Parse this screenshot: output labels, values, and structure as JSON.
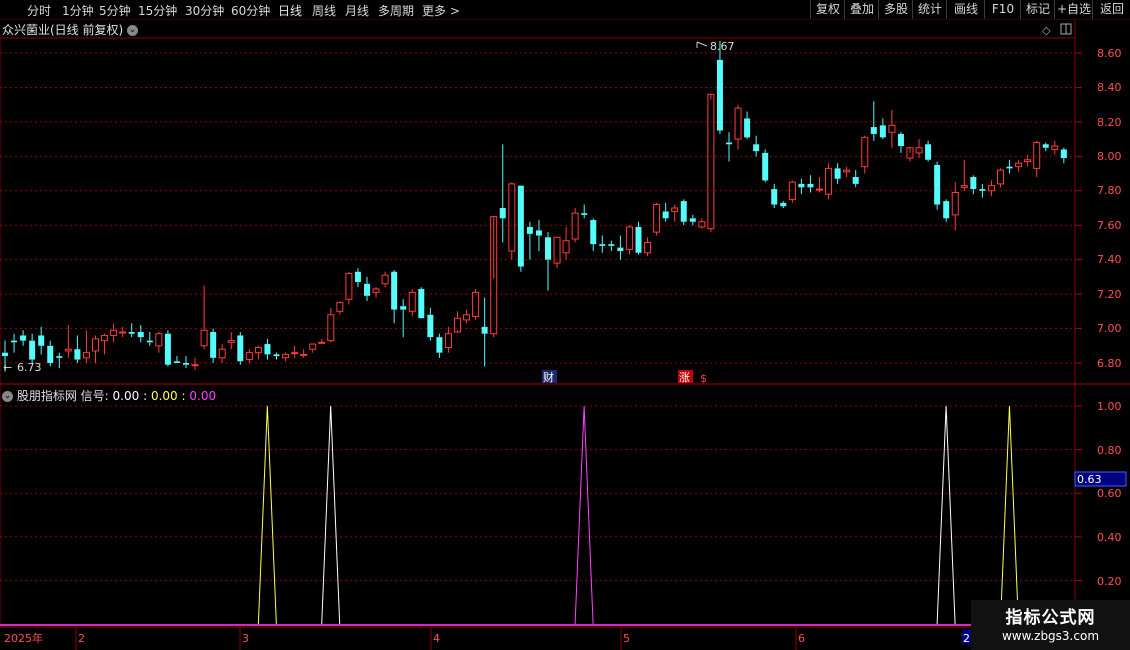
{
  "toolbar": {
    "left": [
      "分时",
      "1分钟",
      "5分钟",
      "15分钟",
      "30分钟",
      "60分钟",
      "日线",
      "周线",
      "月线",
      "多周期",
      "更多 >"
    ],
    "right": [
      "复权",
      "叠加",
      "多股",
      "统计",
      "画线",
      "F10",
      "标记",
      "+自选",
      "返回"
    ],
    "active": "日线"
  },
  "stock": {
    "title": "众兴菌业(日线 前复权)"
  },
  "main_chart": {
    "price_axis": [
      "8.60",
      "8.40",
      "8.20",
      "8.00",
      "7.80",
      "7.60",
      "7.40",
      "7.20",
      "7.00",
      "6.80"
    ],
    "high_label": "8.67",
    "low_label": "6.73",
    "markers": {
      "finance": "财",
      "rise": "涨",
      "dollar": "$"
    }
  },
  "indicator": {
    "name": "股朋指标网",
    "signal_label": "信号:",
    "v1": "0.00",
    "v2": "0.00",
    "v3": "0.00",
    "axis": [
      "1.00",
      "0.80",
      "0.60",
      "0.40",
      "0.20"
    ],
    "current": "0.63"
  },
  "date_axis": {
    "year": "2025年",
    "months": [
      "2",
      "3",
      "4",
      "5",
      "6"
    ],
    "last": "2"
  },
  "watermark": {
    "line1": "指标公式网",
    "line2": "www.zbgs3.com"
  },
  "colors": {
    "up": "#ff3b3b",
    "down": "#54fcfc",
    "yellow": "#ffff55",
    "white": "#ffffff",
    "magenta": "#ff44ff",
    "grid": "#8b0000"
  },
  "chart_data": {
    "type": "candlestick",
    "title": "众兴菌业(日线 前复权)",
    "ylim": [
      6.7,
      8.7
    ],
    "candles": [
      [
        6.86,
        6.93,
        6.84,
        6.75
      ],
      [
        6.93,
        6.97,
        6.92,
        6.86
      ],
      [
        6.96,
        6.99,
        6.93,
        6.9
      ],
      [
        6.93,
        6.97,
        6.82,
        6.8
      ],
      [
        6.96,
        7.01,
        6.9,
        6.85
      ],
      [
        6.9,
        6.93,
        6.8,
        6.78
      ],
      [
        6.84,
        6.86,
        6.83,
        6.77
      ],
      [
        6.87,
        7.02,
        6.88,
        6.83
      ],
      [
        6.88,
        6.96,
        6.82,
        6.8
      ],
      [
        6.83,
        6.99,
        6.86,
        6.8
      ],
      [
        6.87,
        6.96,
        6.94,
        6.8
      ],
      [
        6.93,
        6.97,
        6.96,
        6.85
      ],
      [
        6.96,
        7.03,
        6.99,
        6.92
      ],
      [
        6.98,
        7.01,
        6.98,
        6.95
      ],
      [
        6.98,
        7.03,
        6.97,
        6.95
      ],
      [
        6.98,
        7.02,
        6.95,
        6.92
      ],
      [
        6.93,
        6.98,
        6.92,
        6.9
      ],
      [
        6.9,
        6.98,
        6.97,
        6.86
      ],
      [
        6.97,
        6.99,
        6.79,
        6.78
      ],
      [
        6.81,
        6.84,
        6.8,
        6.8
      ],
      [
        6.8,
        6.84,
        6.79,
        6.77
      ],
      [
        6.79,
        6.83,
        6.79,
        6.76
      ],
      [
        6.9,
        7.25,
        6.99,
        6.88
      ],
      [
        6.98,
        7.0,
        6.83,
        6.8
      ],
      [
        6.83,
        6.91,
        6.88,
        6.8
      ],
      [
        6.92,
        6.98,
        6.93,
        6.88
      ],
      [
        6.96,
        6.98,
        6.81,
        6.79
      ],
      [
        6.82,
        6.88,
        6.86,
        6.8
      ],
      [
        6.86,
        6.9,
        6.89,
        6.82
      ],
      [
        6.91,
        6.94,
        6.85,
        6.82
      ],
      [
        6.85,
        6.86,
        6.84,
        6.82
      ],
      [
        6.83,
        6.86,
        6.85,
        6.81
      ],
      [
        6.86,
        6.9,
        6.86,
        6.83
      ],
      [
        6.85,
        6.88,
        6.85,
        6.83
      ],
      [
        6.88,
        6.91,
        6.91,
        6.86
      ],
      [
        6.92,
        6.94,
        6.92,
        6.92
      ],
      [
        6.93,
        7.12,
        7.08,
        6.92
      ],
      [
        7.1,
        7.16,
        7.15,
        7.08
      ],
      [
        7.17,
        7.33,
        7.32,
        7.14
      ],
      [
        7.33,
        7.35,
        7.27,
        7.24
      ],
      [
        7.26,
        7.3,
        7.19,
        7.16
      ],
      [
        7.21,
        7.24,
        7.23,
        7.18
      ],
      [
        7.26,
        7.33,
        7.31,
        7.24
      ],
      [
        7.33,
        7.34,
        7.11,
        7.03
      ],
      [
        7.13,
        7.17,
        7.11,
        6.95
      ],
      [
        7.1,
        7.23,
        7.21,
        7.07
      ],
      [
        7.23,
        7.24,
        7.06,
        7.06
      ],
      [
        7.08,
        7.12,
        6.95,
        6.93
      ],
      [
        6.95,
        6.97,
        6.86,
        6.83
      ],
      [
        6.89,
        7.01,
        6.97,
        6.86
      ],
      [
        6.98,
        7.1,
        7.06,
        6.99
      ],
      [
        7.05,
        7.11,
        7.08,
        7.03
      ],
      [
        7.07,
        7.23,
        7.21,
        7.05
      ],
      [
        7.01,
        7.18,
        6.97,
        6.78
      ],
      [
        6.97,
        7.29,
        7.65,
        6.95
      ],
      [
        7.7,
        8.07,
        7.64,
        7.5
      ],
      [
        7.45,
        7.85,
        7.84,
        7.4
      ],
      [
        7.83,
        7.83,
        7.36,
        7.33
      ],
      [
        7.59,
        7.62,
        7.55,
        7.4
      ],
      [
        7.57,
        7.63,
        7.54,
        7.45
      ],
      [
        7.53,
        7.56,
        7.4,
        7.22
      ],
      [
        7.38,
        7.53,
        7.53,
        7.35
      ],
      [
        7.44,
        7.59,
        7.51,
        7.4
      ],
      [
        7.52,
        7.7,
        7.67,
        7.5
      ],
      [
        7.67,
        7.72,
        7.66,
        7.64
      ],
      [
        7.63,
        7.64,
        7.49,
        7.45
      ],
      [
        7.49,
        7.54,
        7.48,
        7.44
      ],
      [
        7.49,
        7.51,
        7.48,
        7.45
      ],
      [
        7.47,
        7.54,
        7.45,
        7.4
      ],
      [
        7.46,
        7.6,
        7.59,
        7.43
      ],
      [
        7.59,
        7.62,
        7.44,
        7.43
      ],
      [
        7.44,
        7.53,
        7.5,
        7.42
      ],
      [
        7.56,
        7.73,
        7.72,
        7.54
      ],
      [
        7.68,
        7.73,
        7.64,
        7.62
      ],
      [
        7.68,
        7.72,
        7.7,
        7.62
      ],
      [
        7.74,
        7.75,
        7.62,
        7.6
      ],
      [
        7.64,
        7.66,
        7.62,
        7.6
      ],
      [
        7.59,
        7.64,
        7.62,
        7.58
      ],
      [
        7.58,
        8.33,
        8.36,
        7.56
      ],
      [
        8.56,
        8.67,
        8.15,
        8.13
      ],
      [
        8.08,
        8.14,
        8.07,
        7.97
      ],
      [
        8.1,
        8.3,
        8.28,
        8.04
      ],
      [
        8.22,
        8.26,
        8.11,
        8.1
      ],
      [
        8.07,
        8.12,
        8.03,
        8.0
      ],
      [
        8.02,
        8.04,
        7.86,
        7.85
      ],
      [
        7.81,
        7.84,
        7.72,
        7.7
      ],
      [
        7.73,
        7.74,
        7.71,
        7.7
      ],
      [
        7.75,
        7.86,
        7.85,
        7.73
      ],
      [
        7.84,
        7.87,
        7.82,
        7.78
      ],
      [
        7.84,
        7.89,
        7.82,
        7.79
      ],
      [
        7.81,
        7.88,
        7.81,
        7.79
      ],
      [
        7.78,
        7.96,
        7.93,
        7.75
      ],
      [
        7.93,
        7.96,
        7.87,
        7.84
      ],
      [
        7.91,
        7.94,
        7.92,
        7.88
      ],
      [
        7.88,
        7.92,
        7.84,
        7.82
      ],
      [
        7.94,
        8.12,
        8.11,
        7.9
      ],
      [
        8.17,
        8.32,
        8.13,
        8.09
      ],
      [
        8.18,
        8.22,
        8.11,
        8.1
      ],
      [
        8.14,
        8.27,
        8.18,
        8.05
      ],
      [
        8.13,
        8.14,
        8.06,
        8.02
      ],
      [
        7.99,
        8.02,
        8.05,
        7.97
      ],
      [
        8.02,
        8.1,
        8.05,
        7.99
      ],
      [
        8.07,
        8.09,
        7.98,
        7.97
      ],
      [
        7.95,
        7.97,
        7.72,
        7.69
      ],
      [
        7.74,
        7.75,
        7.64,
        7.62
      ],
      [
        7.66,
        7.85,
        7.79,
        7.57
      ],
      [
        7.82,
        7.98,
        7.83,
        7.8
      ],
      [
        7.88,
        7.89,
        7.81,
        7.78
      ],
      [
        7.81,
        7.84,
        7.8,
        7.76
      ],
      [
        7.8,
        7.86,
        7.83,
        7.77
      ],
      [
        7.84,
        7.93,
        7.92,
        7.82
      ],
      [
        7.94,
        7.98,
        7.93,
        7.9
      ],
      [
        7.94,
        7.98,
        7.96,
        7.91
      ],
      [
        7.97,
        8.01,
        7.98,
        7.94
      ],
      [
        7.93,
        8.09,
        8.08,
        7.88
      ],
      [
        8.07,
        8.08,
        8.05,
        8.03
      ],
      [
        8.04,
        8.09,
        8.06,
        8.01
      ],
      [
        8.04,
        8.05,
        7.99,
        7.96
      ]
    ],
    "signals": [
      {
        "index": 27,
        "color": "yellow",
        "value": 1.0
      },
      {
        "index": 34,
        "color": "white",
        "value": 1.0
      },
      {
        "index": 62,
        "color": "magenta",
        "value": 1.0
      },
      {
        "index": 102,
        "color": "white",
        "value": 1.0
      },
      {
        "index": 109,
        "color": "yellow",
        "value": 1.0
      }
    ],
    "indicator_ylim": [
      0,
      1.0
    ]
  }
}
